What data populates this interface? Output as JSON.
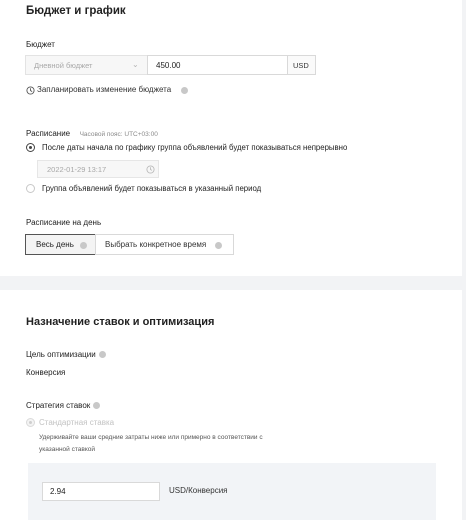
{
  "budget": {
    "title": "Бюджет и график",
    "budget_label": "Бюджет",
    "budget_type": "Дневной бюджет",
    "amount": "450.00",
    "currency": "USD",
    "schedule_change_link": "Запланировать изменение бюджета"
  },
  "schedule": {
    "label": "Расписание",
    "timezone": "Часовой пояс: UTC+03:00",
    "option_continuous": "После даты начала по графику группа объявлений будет показываться непрерывно",
    "start_date": "2022-01-29 13:17",
    "option_period": "Группа объявлений будет показываться в указанный период"
  },
  "day_schedule": {
    "label": "Расписание на день",
    "tab_all_day": "Весь день",
    "tab_specific": "Выбрать конкретное время"
  },
  "bidding": {
    "title": "Назначение ставок и оптимизация",
    "goal_label": "Цель оптимизации",
    "goal_value": "Конверсия",
    "strategy_label": "Стратегия ставок",
    "strategy_option": "Стандартная ставка",
    "strategy_desc_line1": "Удерживайте ваши средние затраты ниже или примерно в соответствии с",
    "strategy_desc_line2": "указанной ставкой",
    "bid_value": "2.94",
    "bid_unit": "USD/Конверсия"
  }
}
